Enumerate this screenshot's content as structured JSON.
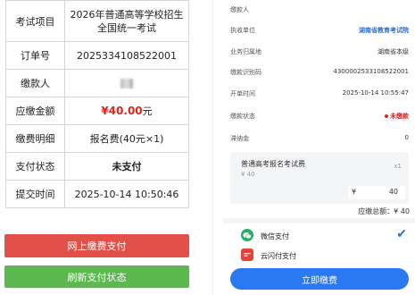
{
  "left": {
    "rows": [
      {
        "key": "考试项目",
        "value": "2026年普通高等学校招生全国统一考试"
      },
      {
        "key": "订单号",
        "value": "2025334108522001"
      },
      {
        "key": "缴款人",
        "value": ""
      },
      {
        "key": "应缴金额",
        "value": "¥40.00",
        "unit": "元"
      },
      {
        "key": "缴费明细",
        "value": "报名费(40元×1)"
      },
      {
        "key": "支付状态",
        "value": "未支付"
      },
      {
        "key": "提交时间",
        "value": "2025-10-14 10:50:46"
      }
    ],
    "buttons": {
      "pay_online": "网上缴费支付",
      "refresh": "刷新支付状态"
    }
  },
  "right": {
    "rows": [
      {
        "key": "缴款人",
        "value": ""
      },
      {
        "key": "执收单位",
        "value": "湖南省教育考试院"
      },
      {
        "key": "业务归属地",
        "value": "湖南省本级"
      },
      {
        "key": "缴款识别码",
        "value": "4300002533108522001"
      },
      {
        "key": "开单时间",
        "value": "2025-10-14 10:55:47"
      },
      {
        "key": "缴款状态",
        "value": "未缴款"
      },
      {
        "key": "滞纳金",
        "value": "0"
      }
    ],
    "item": {
      "title": "普通高考报名考试费",
      "price": "¥ 40",
      "qty": "x1",
      "yen": "¥",
      "amount": "40"
    },
    "total": "应缴总额：¥ 40",
    "payments": [
      {
        "label": "微信支付",
        "icon": "wechat-pay-icon",
        "color": "#2aae67",
        "selected": true
      },
      {
        "label": "云闪付支付",
        "icon": "unionpay-icon",
        "color": "#e2443b",
        "selected": false
      }
    ],
    "check_mark": "✔",
    "pay_button": "立即缴费"
  }
}
